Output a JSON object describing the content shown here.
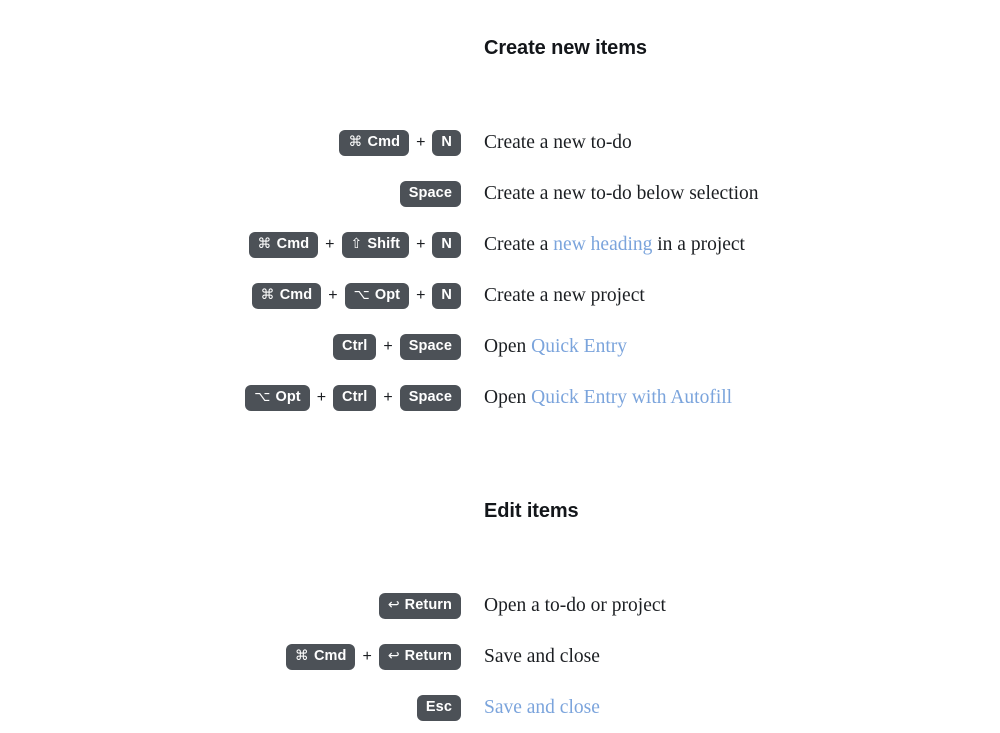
{
  "theme": {
    "background": "#ffffff",
    "text_color": "#1b1e22",
    "heading_color": "#13161a",
    "link_color": "#7ba4dc",
    "keycap_background": "#4c5157",
    "keycap_text": "#ffffff",
    "plus_color": "#1b1e22"
  },
  "separator": "+",
  "sections": [
    {
      "heading": "Create new items",
      "rows": [
        {
          "keys": [
            {
              "symbol": "⌘",
              "label": "Cmd",
              "icon_name": "command-key-icon"
            },
            {
              "symbol": "",
              "label": "N",
              "icon_name": ""
            }
          ],
          "parts": [
            {
              "text": "Create a new to-do",
              "link": false
            }
          ]
        },
        {
          "keys": [
            {
              "symbol": "",
              "label": "Space",
              "icon_name": ""
            }
          ],
          "parts": [
            {
              "text": "Create a new to-do below selection",
              "link": false
            }
          ]
        },
        {
          "keys": [
            {
              "symbol": "⌘",
              "label": "Cmd",
              "icon_name": "command-key-icon"
            },
            {
              "symbol": "⇧",
              "label": "Shift",
              "icon_name": "shift-key-icon"
            },
            {
              "symbol": "",
              "label": "N",
              "icon_name": ""
            }
          ],
          "parts": [
            {
              "text": "Create a ",
              "link": false
            },
            {
              "text": "new heading",
              "link": true
            },
            {
              "text": " in a project",
              "link": false
            }
          ]
        },
        {
          "keys": [
            {
              "symbol": "⌘",
              "label": "Cmd",
              "icon_name": "command-key-icon"
            },
            {
              "symbol": "⌥",
              "label": "Opt",
              "icon_name": "option-key-icon"
            },
            {
              "symbol": "",
              "label": "N",
              "icon_name": ""
            }
          ],
          "parts": [
            {
              "text": "Create a new project",
              "link": false
            }
          ]
        },
        {
          "keys": [
            {
              "symbol": "",
              "label": "Ctrl",
              "icon_name": ""
            },
            {
              "symbol": "",
              "label": "Space",
              "icon_name": ""
            }
          ],
          "parts": [
            {
              "text": "Open ",
              "link": false
            },
            {
              "text": "Quick Entry",
              "link": true
            }
          ]
        },
        {
          "keys": [
            {
              "symbol": "⌥",
              "label": "Opt",
              "icon_name": "option-key-icon"
            },
            {
              "symbol": "",
              "label": "Ctrl",
              "icon_name": ""
            },
            {
              "symbol": "",
              "label": "Space",
              "icon_name": ""
            }
          ],
          "parts": [
            {
              "text": "Open ",
              "link": false
            },
            {
              "text": "Quick Entry with Autofill",
              "link": true
            }
          ]
        }
      ]
    },
    {
      "heading": "Edit items",
      "rows": [
        {
          "keys": [
            {
              "symbol": "↩",
              "label": "Return",
              "icon_name": "return-key-icon"
            }
          ],
          "parts": [
            {
              "text": "Open a to-do or project",
              "link": false
            }
          ]
        },
        {
          "keys": [
            {
              "symbol": "⌘",
              "label": "Cmd",
              "icon_name": "command-key-icon"
            },
            {
              "symbol": "↩",
              "label": "Return",
              "icon_name": "return-key-icon"
            }
          ],
          "parts": [
            {
              "text": "Save and close",
              "link": false
            }
          ]
        },
        {
          "keys": [
            {
              "symbol": "",
              "label": "Esc",
              "icon_name": ""
            }
          ],
          "parts": [
            {
              "text": "Save and close",
              "link": true
            }
          ]
        }
      ]
    }
  ]
}
